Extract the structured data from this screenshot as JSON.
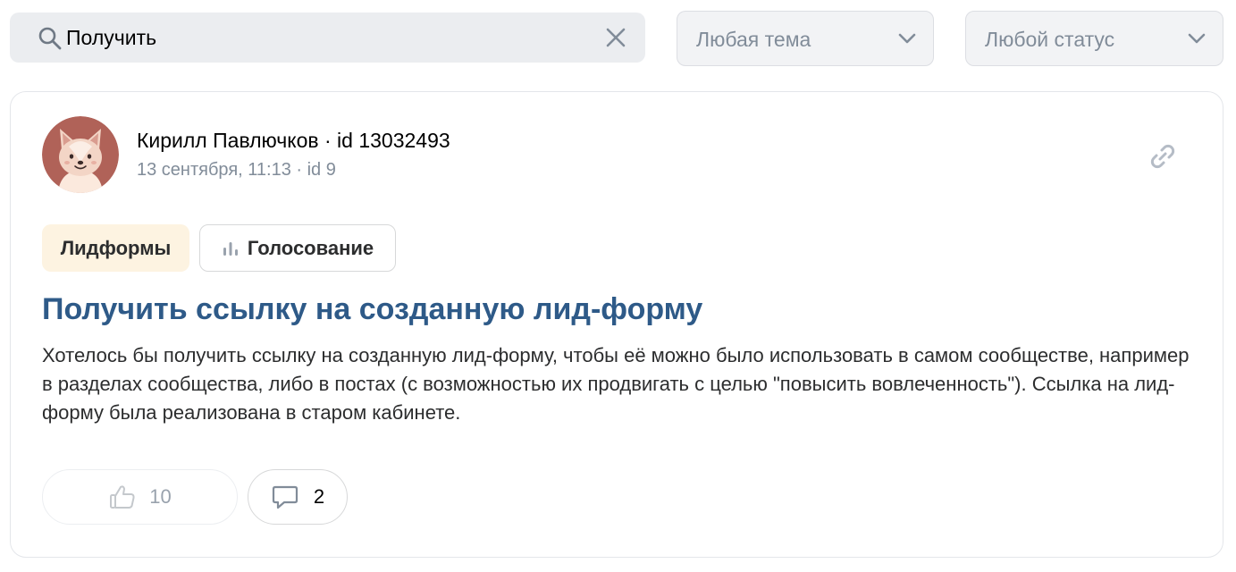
{
  "search": {
    "value": "Получить",
    "icon": "search-icon",
    "clear_icon": "close-icon"
  },
  "filters": {
    "theme_label": "Любая тема",
    "status_label": "Любой статус"
  },
  "post": {
    "author": "Кирилл Павлючков · id 13032493",
    "meta": "13 сентября, 11:13 · id 9",
    "tags": [
      "Лидформы",
      "Голосование"
    ],
    "title": "Получить ссылку на созданную лид-форму",
    "body": "Хотелось бы получить ссылку на созданную лид-форму, чтобы её можно было использовать в самом сообществе, например в разделах сообщества, либо в постах (с возможностью их продвигать с целью \"повысить вовлеченность\"). Ссылка на лид-форму была реализована в старом кабинете.",
    "likes": "10",
    "comments": "2"
  },
  "colors": {
    "accent_title": "#2e5a88",
    "tag_lead_bg": "#fdf3e1",
    "search_bg": "#ebedf0",
    "muted_text": "#818c99"
  }
}
